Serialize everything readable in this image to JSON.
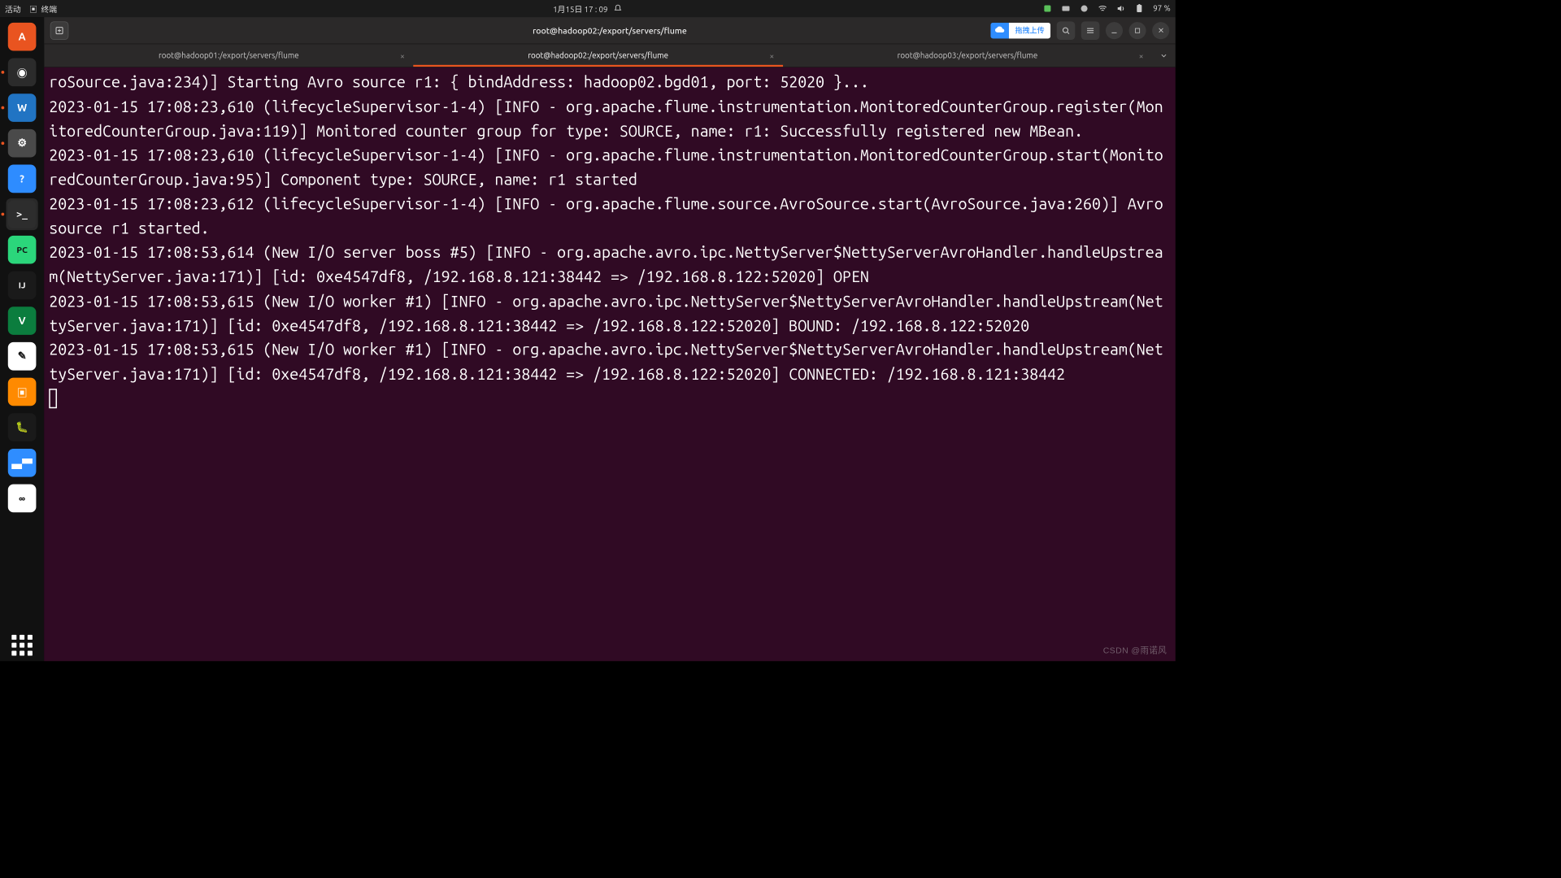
{
  "topbar": {
    "activities": "活动",
    "app_indicator": "终端",
    "clock": "1月15日  17 : 09",
    "battery": "97 %"
  },
  "headerbar": {
    "title": "root@hadoop02:/export/servers/flume",
    "upload_label": "拖拽上传"
  },
  "tabs": [
    {
      "label": "root@hadoop01:/export/servers/flume",
      "active": false
    },
    {
      "label": "root@hadoop02:/export/servers/flume",
      "active": true
    },
    {
      "label": "root@hadoop03:/export/servers/flume",
      "active": false
    }
  ],
  "dock": [
    {
      "name": "ubuntu-software",
      "bg": "#E95420",
      "glyph": "A"
    },
    {
      "name": "rhythmbox",
      "bg": "#2b2b2b",
      "glyph": "◉"
    },
    {
      "name": "libreoffice-writer",
      "bg": "#2174c3",
      "glyph": "W"
    },
    {
      "name": "settings",
      "bg": "#4a4a4a",
      "glyph": "⚙"
    },
    {
      "name": "help",
      "bg": "#2e8cff",
      "glyph": "?"
    },
    {
      "name": "terminal",
      "bg": "#2d2d2d",
      "glyph": ">_"
    },
    {
      "name": "pycharm",
      "bg": "#2bd67b",
      "glyph": "PC"
    },
    {
      "name": "intellij",
      "bg": "#1a1a1a",
      "glyph": "IJ"
    },
    {
      "name": "vim",
      "bg": "#0b7d3e",
      "glyph": "V"
    },
    {
      "name": "text-editor",
      "bg": "#ffffff",
      "glyph": "✎"
    },
    {
      "name": "vmware",
      "bg": "#ff8a00",
      "glyph": "▣"
    },
    {
      "name": "monitor",
      "bg": "#1a1a1a",
      "glyph": "🐛"
    },
    {
      "name": "meeting",
      "bg": "#2f8dff",
      "glyph": "▄▀"
    },
    {
      "name": "baidu-netdisk",
      "bg": "#ffffff",
      "glyph": "∞"
    }
  ],
  "terminal_output": "roSource.java:234)] Starting Avro source r1: { bindAddress: hadoop02.bgd01, port: 52020 }...\n2023-01-15 17:08:23,610 (lifecycleSupervisor-1-4) [INFO - org.apache.flume.instrumentation.MonitoredCounterGroup.register(MonitoredCounterGroup.java:119)] Monitored counter group for type: SOURCE, name: r1: Successfully registered new MBean.\n2023-01-15 17:08:23,610 (lifecycleSupervisor-1-4) [INFO - org.apache.flume.instrumentation.MonitoredCounterGroup.start(MonitoredCounterGroup.java:95)] Component type: SOURCE, name: r1 started\n2023-01-15 17:08:23,612 (lifecycleSupervisor-1-4) [INFO - org.apache.flume.source.AvroSource.start(AvroSource.java:260)] Avro source r1 started.\n2023-01-15 17:08:53,614 (New I/O server boss #5) [INFO - org.apache.avro.ipc.NettyServer$NettyServerAvroHandler.handleUpstream(NettyServer.java:171)] [id: 0xe4547df8, /192.168.8.121:38442 => /192.168.8.122:52020] OPEN\n2023-01-15 17:08:53,615 (New I/O worker #1) [INFO - org.apache.avro.ipc.NettyServer$NettyServerAvroHandler.handleUpstream(NettyServer.java:171)] [id: 0xe4547df8, /192.168.8.121:38442 => /192.168.8.122:52020] BOUND: /192.168.8.122:52020\n2023-01-15 17:08:53,615 (New I/O worker #1) [INFO - org.apache.avro.ipc.NettyServer$NettyServerAvroHandler.handleUpstream(NettyServer.java:171)] [id: 0xe4547df8, /192.168.8.121:38442 => /192.168.8.122:52020] CONNECTED: /192.168.8.121:38442",
  "watermark": "CSDN @雨诺风"
}
